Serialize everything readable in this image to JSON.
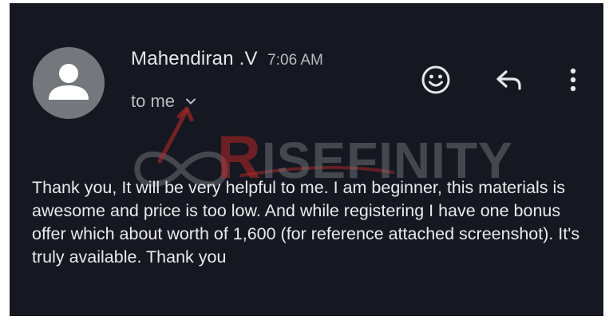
{
  "email": {
    "sender_name": "Mahendiran .V",
    "time": "7:06 AM",
    "recipient": "to me",
    "body": "Thank you, It will be very helpful to me. I am beginner, this materials is awesome and price is too low. And while registering I have one bonus offer which about worth of 1,600 (for reference attached screenshot). It's truly available. Thank you"
  },
  "icons": {
    "avatar": "person-icon",
    "recipient_toggle": "chevron-down-icon",
    "emoji": "emoji-icon",
    "reply": "reply-icon",
    "more": "more-vertical-icon"
  },
  "watermark": {
    "first_letter": "R",
    "rest": "ISEFINITY"
  },
  "colors": {
    "background": "#151820",
    "primary_text": "#e6e7ea",
    "secondary_text": "#b9bcc2",
    "avatar_bg": "#74787d",
    "watermark_red": "#b42828",
    "watermark_gray": "#6e7076"
  }
}
